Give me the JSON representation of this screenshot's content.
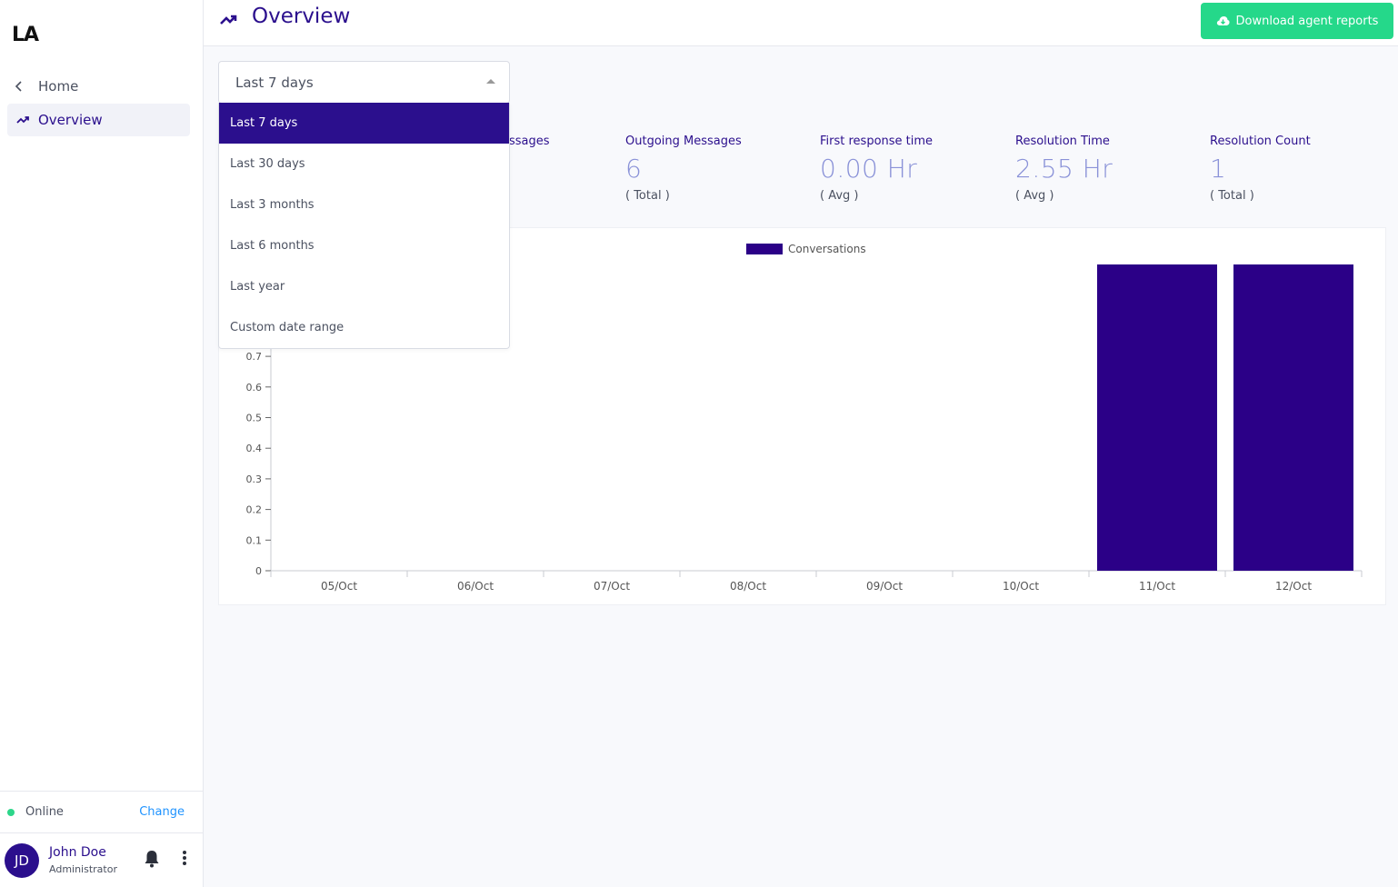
{
  "sidebar": {
    "logo": "LA",
    "home_label": "Home",
    "overview_label": "Overview",
    "status": {
      "text": "Online",
      "change_label": "Change",
      "color": "#2dd68a"
    },
    "user": {
      "initials": "JD",
      "name": "John Doe",
      "role": "Administrator"
    }
  },
  "header": {
    "title": "Overview",
    "download_label": "Download agent reports"
  },
  "date_filter": {
    "selected": "Last 7 days",
    "options": [
      "Last 7 days",
      "Last 30 days",
      "Last 3 months",
      "Last 6 months",
      "Last year",
      "Custom date range"
    ]
  },
  "metrics": [
    {
      "label": "ssages",
      "value": "",
      "sub": ""
    },
    {
      "label": "Outgoing Messages",
      "value": "6",
      "sub": "( Total )"
    },
    {
      "label": "First response time",
      "value": "0.00 Hr",
      "sub": "( Avg )"
    },
    {
      "label": "Resolution Time",
      "value": "2.55 Hr",
      "sub": "( Avg )"
    },
    {
      "label": "Resolution Count",
      "value": "1",
      "sub": "( Total )"
    }
  ],
  "colors": {
    "accent": "#2b0f8d",
    "download": "#25d88a",
    "bar": "#2b0087"
  },
  "chart_data": {
    "type": "bar",
    "categories": [
      "05/Oct",
      "06/Oct",
      "07/Oct",
      "08/Oct",
      "09/Oct",
      "10/Oct",
      "11/Oct",
      "12/Oct"
    ],
    "series": [
      {
        "name": "Conversations",
        "values": [
          0,
          0,
          0,
          0,
          0,
          0,
          1,
          1
        ]
      }
    ],
    "y_ticks": [
      "0",
      "0.1",
      "0.2",
      "0.3",
      "0.4",
      "0.5",
      "0.6",
      "0.7"
    ],
    "ylim": [
      0,
      1
    ],
    "legend": "top-center",
    "grid": false
  }
}
